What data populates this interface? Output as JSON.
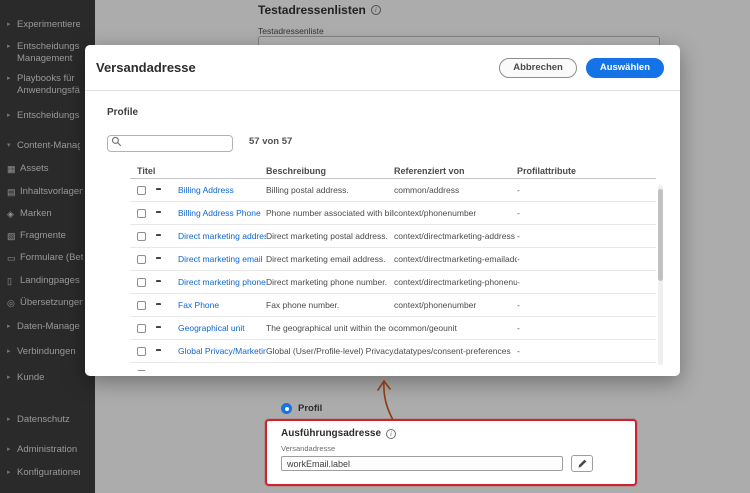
{
  "colors": {
    "accentBlue": "#1473e6",
    "linkBlue": "#0d66d0",
    "annotationRed": "#c9252d",
    "arrowBrown": "#8a3b12"
  },
  "icons": {
    "chevron_right": "▸",
    "chevron_down": "▾",
    "assets": "▦",
    "inhaltsvorlagen": "▤",
    "marken": "◈",
    "fragmente": "▧",
    "formulare": "▭",
    "landingpages": "▯",
    "uebersetzungen": "◎",
    "info": "i"
  },
  "sidebar": {
    "items": [
      {
        "label": "Experimentieren"
      },
      {
        "label": "Entscheidungs-Management"
      },
      {
        "label": "Playbooks für Anwendungsfälle"
      },
      {
        "label": "Entscheidungsregeln"
      },
      {
        "label": "Content-Management"
      },
      {
        "label": "Assets"
      },
      {
        "label": "Inhaltsvorlagen"
      },
      {
        "label": "Marken"
      },
      {
        "label": "Fragmente"
      },
      {
        "label": "Formulare (Beta)"
      },
      {
        "label": "Landingpages"
      },
      {
        "label": "Übersetzungen"
      },
      {
        "label": "Daten-Management"
      },
      {
        "label": "Verbindungen"
      },
      {
        "label": "Kunde"
      },
      {
        "label": "Datenschutz"
      },
      {
        "label": "Administration"
      },
      {
        "label": "Konfigurationen"
      }
    ]
  },
  "background": {
    "page_title": "Testadressenlisten",
    "field_label": "Testadressenliste",
    "radio_label": "Profil"
  },
  "modal": {
    "title": "Versandadresse",
    "cancel_label": "Abbrechen",
    "confirm_label": "Auswählen",
    "section_label": "Profile",
    "result_count": "57 von 57",
    "table": {
      "columns": [
        "Titel",
        "Beschreibung",
        "Referenziert von",
        "Profilattribute"
      ],
      "rows": [
        {
          "title": "Billing Address",
          "description": "Billing postal address.",
          "referenced_by": "common/address",
          "profile_attributes": "-"
        },
        {
          "title": "Billing Address Phone",
          "description": "Phone number associated with billin",
          "referenced_by": "context/phonenumber",
          "profile_attributes": "-"
        },
        {
          "title": "Direct marketing address",
          "description": "Direct marketing postal address.",
          "referenced_by": "context/directmarketing-address",
          "profile_attributes": "-"
        },
        {
          "title": "Direct marketing email",
          "description": "Direct marketing email address.",
          "referenced_by": "context/directmarketing-emailaddre",
          "profile_attributes": "-"
        },
        {
          "title": "Direct marketing phone",
          "description": "Direct marketing phone number.",
          "referenced_by": "context/directmarketing-phonenum",
          "profile_attributes": "-"
        },
        {
          "title": "Fax Phone",
          "description": "Fax phone number.",
          "referenced_by": "context/phonenumber",
          "profile_attributes": "-"
        },
        {
          "title": "Geographical unit",
          "description": "The geographical unit within the org",
          "referenced_by": "common/geounit",
          "profile_attributes": "-"
        },
        {
          "title": "Global Privacy/Marketing Profi",
          "description": "Global (User/Profile-level) Privacy/Pr",
          "referenced_by": "datatypes/consent-preferences",
          "profile_attributes": "-"
        }
      ]
    }
  },
  "annotation": {
    "title": "Ausführungsadresse",
    "field_label": "Versandadresse",
    "field_value": "workEmail.label"
  }
}
